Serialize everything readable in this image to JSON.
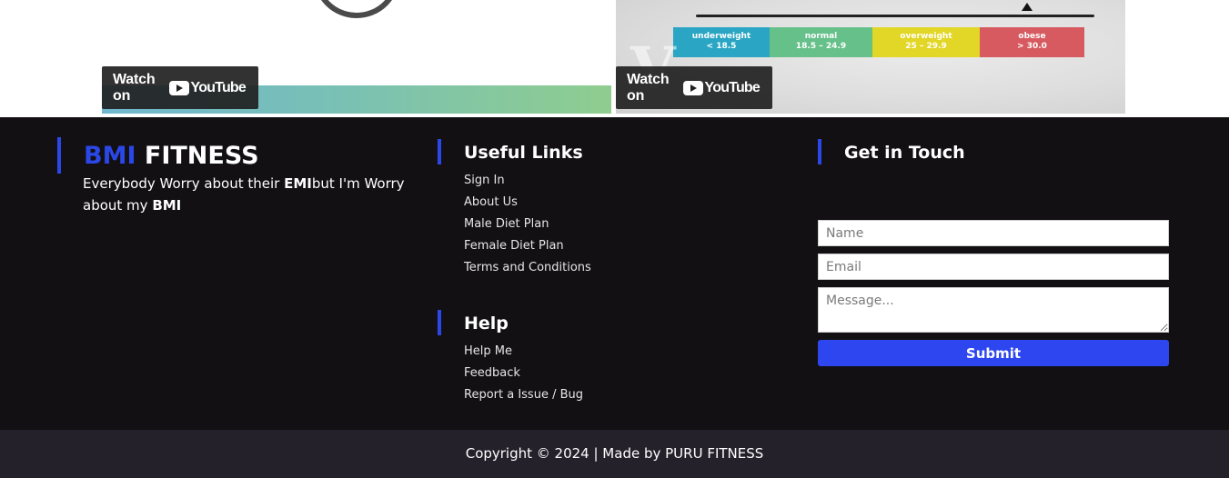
{
  "videos": {
    "left": {
      "watch_label": "Watch on",
      "youtube_label": "YouTube"
    },
    "right": {
      "watch_label": "Watch on",
      "youtube_label": "YouTube",
      "watermark": "Vox",
      "bmi_categories": [
        {
          "name": "underweight",
          "range": "< 18.5",
          "color": "#2aa6c4"
        },
        {
          "name": "normal",
          "range": "18.5 – 24.9",
          "color": "#66c08a"
        },
        {
          "name": "overweight",
          "range": "25 – 29.9",
          "color": "#e2d626"
        },
        {
          "name": "obese",
          "range": "> 30.0",
          "color": "#d65a5f"
        }
      ]
    }
  },
  "footer": {
    "brand": {
      "title_accent": "BMI",
      "title_rest": " FITNESS",
      "tagline_part1": "Everybody Worry about their ",
      "tagline_bold1": "EMI",
      "tagline_part2": "but I'm Worry about my ",
      "tagline_bold2": "BMI"
    },
    "useful_links": {
      "heading": "Useful Links",
      "items": [
        "Sign In",
        "About Us",
        "Male Diet Plan",
        "Female Diet Plan",
        "Terms and Conditions"
      ]
    },
    "help": {
      "heading": "Help",
      "items": [
        "Help Me",
        "Feedback",
        "Report a Issue / Bug"
      ]
    },
    "contact": {
      "heading": "Get in Touch",
      "name_placeholder": "Name",
      "email_placeholder": "Email",
      "message_placeholder": "Message...",
      "submit_label": "Submit"
    },
    "copyright": "Copyright © 2024 | Made by PURU FITNESS"
  },
  "colors": {
    "accent": "#2b47e8",
    "footer_bg": "#121013",
    "copyright_bg": "#24212b",
    "submit_bg": "#2d46ef"
  }
}
